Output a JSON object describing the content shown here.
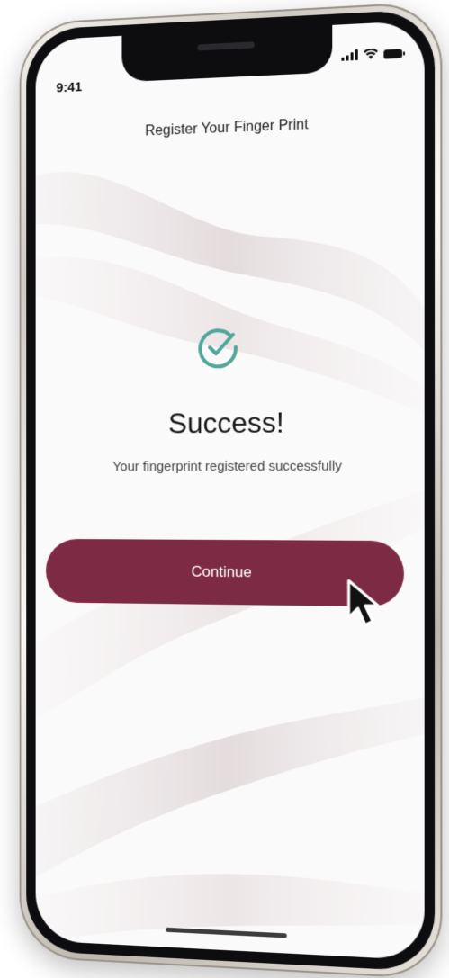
{
  "status_bar": {
    "time": "9:41",
    "signal": "signal-bars-icon",
    "wifi": "wifi-icon",
    "battery": "battery-icon"
  },
  "header": {
    "title": "Register Your Finger Print"
  },
  "result": {
    "icon": "check-circle-icon",
    "heading": "Success!",
    "message": "Your fingerprint registered successfully"
  },
  "actions": {
    "continue_label": "Continue"
  },
  "cursor": {
    "icon": "mouse-pointer-icon"
  },
  "colors": {
    "primary_button": "#7d2a45",
    "check_accent": "#4fa79a",
    "screen_background": "#fbfafa",
    "text_dark": "#1a1a1a"
  }
}
